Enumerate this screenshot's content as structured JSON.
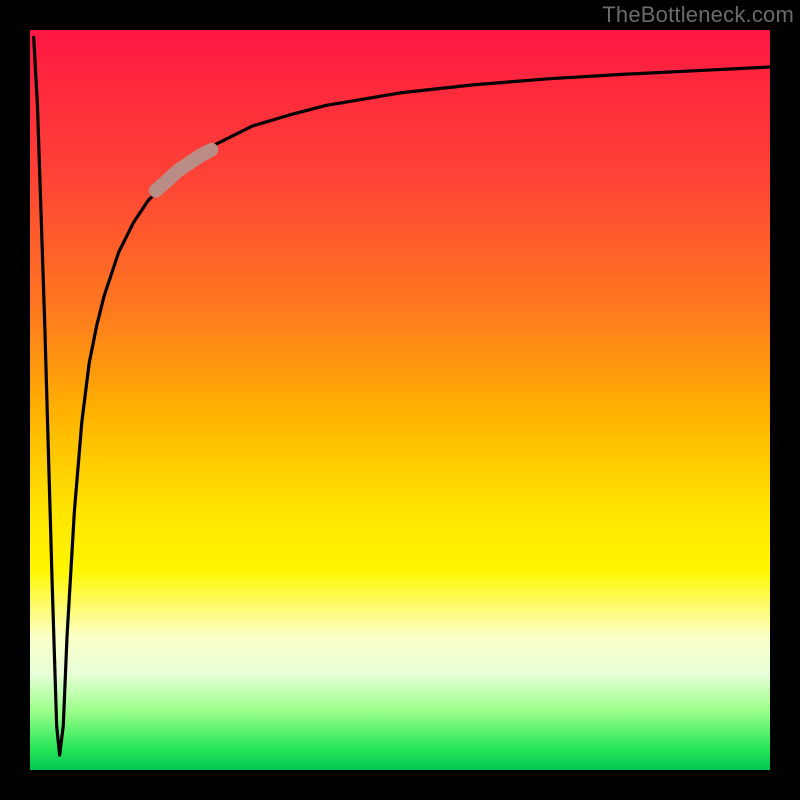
{
  "watermark": "TheBottleneck.com",
  "chart_data": {
    "type": "line",
    "title": "",
    "xlabel": "",
    "ylabel": "",
    "xlim": [
      0,
      100
    ],
    "ylim": [
      0,
      100
    ],
    "grid": false,
    "legend": false,
    "notes": "Background is a rainbow red→green vertical gradient. Curve starts near top-left, dips to near y≈2 around x≈4, then rises asymptotically toward ~95 at right edge. Short rosy-brown marker segment overlaid near x≈17–25.",
    "series": [
      {
        "name": "curve",
        "color": "#000000",
        "x": [
          0.5,
          1,
          2,
          3,
          3.6,
          4,
          4.5,
          5,
          6,
          7,
          8,
          9,
          10,
          12,
          14,
          16,
          18,
          20,
          25,
          30,
          35,
          40,
          50,
          60,
          70,
          80,
          90,
          100
        ],
        "y": [
          99,
          90,
          60,
          25,
          6,
          2,
          6,
          18,
          35,
          47,
          55,
          60,
          64,
          70,
          74,
          77,
          79,
          81,
          84.5,
          87,
          88.5,
          89.8,
          91.5,
          92.6,
          93.4,
          94,
          94.5,
          95
        ]
      },
      {
        "name": "marker-segment",
        "color": "#b98c86",
        "x": [
          17,
          18.5,
          20,
          21.5,
          23,
          24.5
        ],
        "y": [
          78.3,
          79.6,
          81,
          82,
          83,
          83.8
        ]
      }
    ]
  }
}
